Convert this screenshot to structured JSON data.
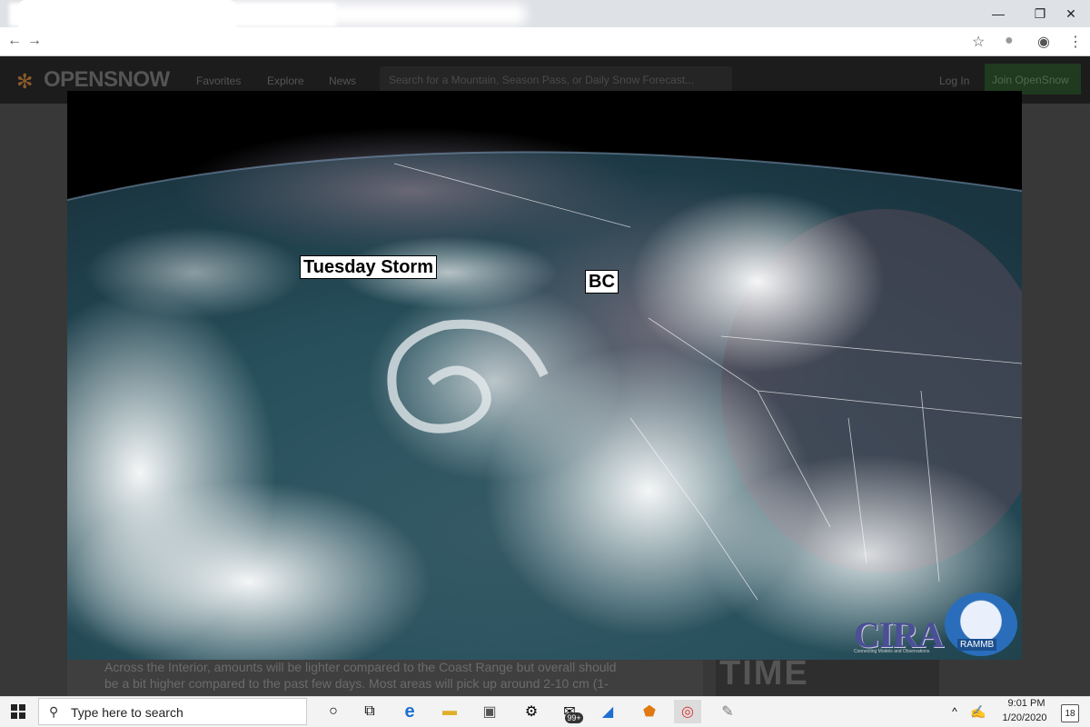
{
  "browser": {
    "window_controls": {
      "minimize": "—",
      "restore": "❐",
      "close": "✕"
    }
  },
  "site": {
    "logo": "OPENSNOW",
    "nav": [
      "Favorites",
      "Explore",
      "News"
    ],
    "search_placeholder": "Search for a Mountain, Season Pass, or Daily Snow Forecast...",
    "login": "Log In",
    "join": "Join OpenSnow"
  },
  "article": {
    "line1": "Across the Interior, amounts will be lighter compared to the Coast Range but overall should",
    "line2": "be a bit higher compared to the past few days.  Most areas will pick up around 2-10 cm (1-",
    "ad_text": "TIME"
  },
  "satellite": {
    "labels": {
      "storm": "Tuesday Storm",
      "bc": "BC"
    },
    "cira": "CIRA",
    "cira_sub": "Connecting Models and Observations",
    "rammb": "RAMMB"
  },
  "taskbar": {
    "search_placeholder": "Type here to search",
    "mail_badge": "99+",
    "time": "9:01 PM",
    "date": "1/20/2020",
    "notifications": "18"
  }
}
